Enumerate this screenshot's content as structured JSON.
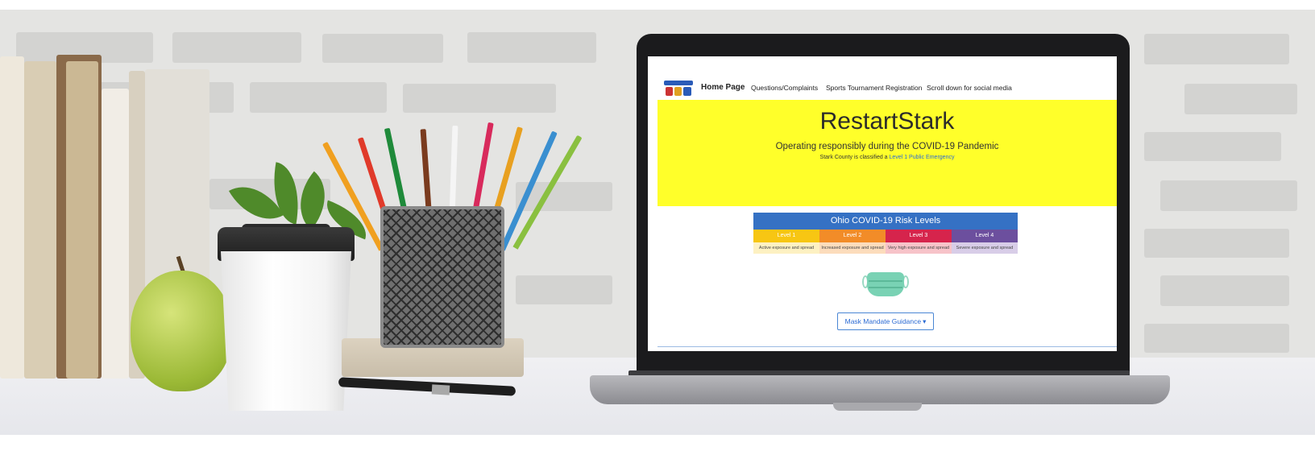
{
  "website": {
    "nav": {
      "home_label": "Home Page",
      "items": [
        {
          "label": "Questions/Complaints"
        },
        {
          "label": "Sports Tournament Registration"
        },
        {
          "label": "Scroll down for social media"
        }
      ]
    },
    "hero": {
      "title": "RestartStark",
      "subtitle": "Operating responsibly during the COVID-19 Pandemic",
      "classification_prefix": "Stark County is classified a",
      "classification_link": "Level 1 Public Emergency",
      "background_color": "#ffff2a"
    },
    "risk_levels": {
      "title": "Ohio COVID-19 Risk Levels",
      "levels": [
        {
          "label": "Level 1",
          "description": "Active exposure and spread",
          "color": "#f7c613",
          "desc_bg": "#fdf1c2"
        },
        {
          "label": "Level 2",
          "description": "Increased exposure and spread",
          "color": "#f28c28",
          "desc_bg": "#fcdcbc"
        },
        {
          "label": "Level 3",
          "description": "Very high exposure and spread",
          "color": "#d6244c",
          "desc_bg": "#f7c3c9"
        },
        {
          "label": "Level 4",
          "description": "Severe exposure and spread",
          "color": "#6c4f9e",
          "desc_bg": "#d8cde8"
        }
      ]
    },
    "mask_guidance_button": "Mask Mandate Guidance",
    "dropdown_caret": "▾"
  },
  "colors": {
    "link": "#2a6ad3",
    "risk_header": "#3571c4"
  }
}
